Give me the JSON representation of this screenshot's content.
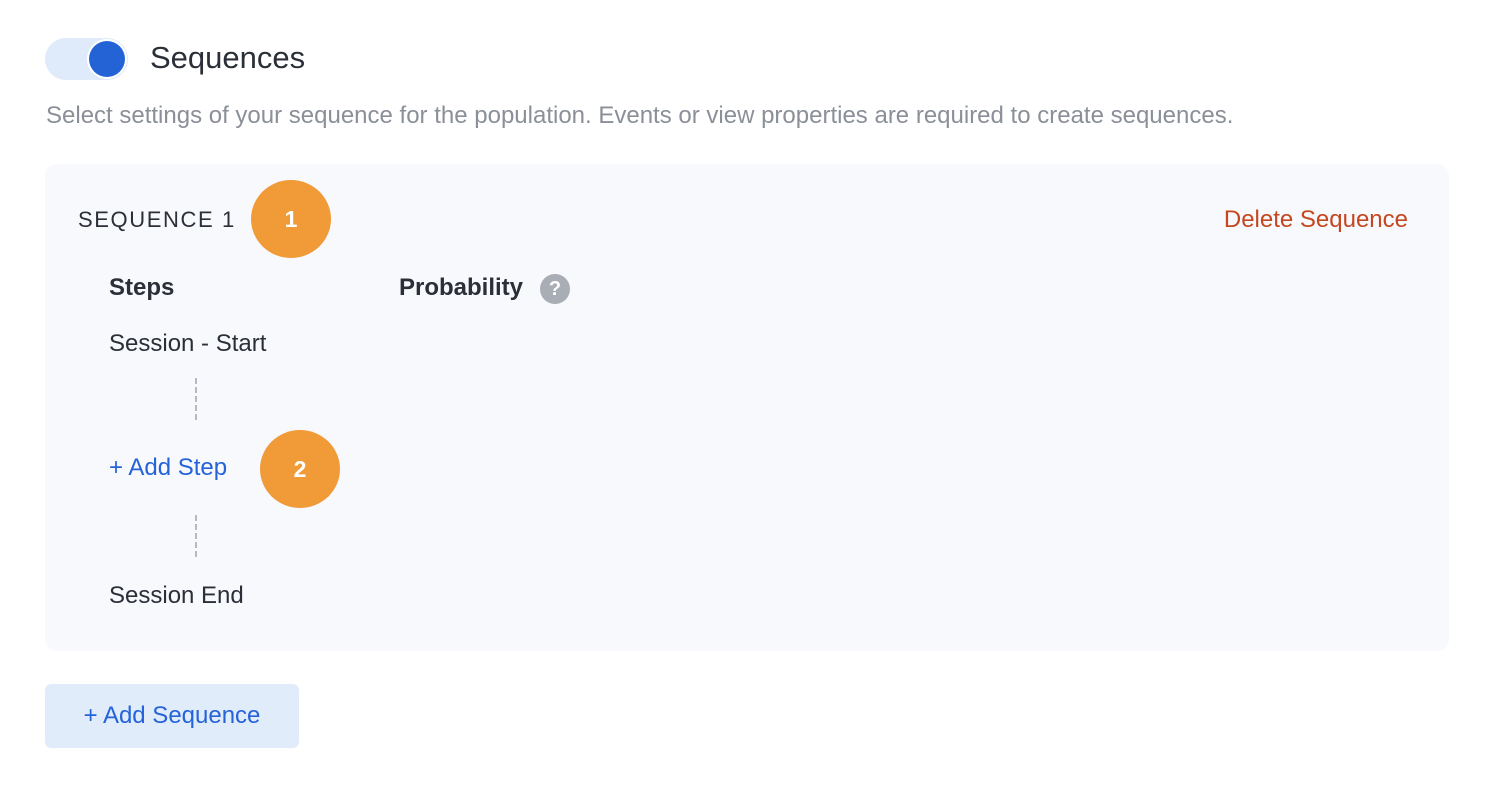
{
  "header": {
    "toggle_state": "on",
    "title": "Sequences",
    "subtitle": "Select settings of your sequence for the population. Events or view properties are required to create sequences."
  },
  "sequence": {
    "label": "SEQUENCE 1",
    "delete_label": "Delete Sequence",
    "columns": {
      "steps": "Steps",
      "probability": "Probability"
    },
    "help_icon": "?",
    "steps": [
      {
        "label": "Session - Start"
      },
      {
        "label": "Session End"
      }
    ],
    "add_step_label": "+ Add Step"
  },
  "badges": [
    "1",
    "2"
  ],
  "add_sequence_label": "+ Add Sequence",
  "colors": {
    "accent": "#2463d6",
    "link": "#2563d8",
    "danger": "#c4471f",
    "badge": "#f19a38",
    "card_background": "#f8f9fc",
    "muted_text": "#8a8f98"
  },
  "icons": {
    "toggle": "toggle-switch-icon",
    "help": "question-circle-icon"
  }
}
